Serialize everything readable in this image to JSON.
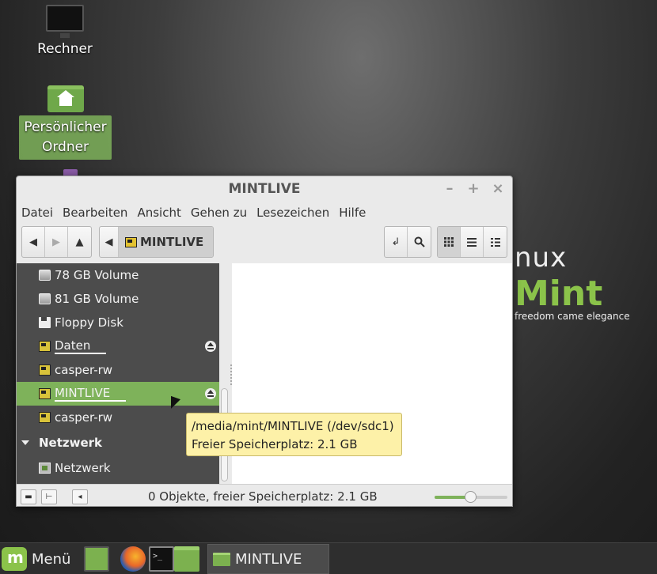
{
  "desktop": {
    "icons": [
      {
        "label": "Rechner"
      },
      {
        "label_line1": "Persönlicher",
        "label_line2": "Ordner"
      }
    ],
    "wallpaper": {
      "logo_part1": "nux",
      "logo_part2": "Mint",
      "slogan": "freedom came elegance"
    }
  },
  "window": {
    "title": "MINTLIVE",
    "controls": {
      "minimize": "–",
      "maximize": "+",
      "close": "×"
    },
    "menu": [
      "Datei",
      "Bearbeiten",
      "Ansicht",
      "Gehen zu",
      "Lesezeichen",
      "Hilfe"
    ],
    "toolbar": {
      "path_label": "MINTLIVE",
      "icons": {
        "back": "arrow-left-icon",
        "forward": "arrow-right-icon",
        "up": "arrow-up-icon",
        "path_toggle": "caret-left-icon",
        "path_drive": "usb-drive-icon",
        "open_terminal": "return-arrow-icon",
        "search": "search-icon",
        "icon_view": "grid-icon",
        "list_view": "list-icon",
        "compact_view": "compact-icon"
      }
    },
    "sidebar": {
      "items": [
        {
          "label": "78 GB Volume",
          "icon": "hard-disk-icon"
        },
        {
          "label": "81 GB Volume",
          "icon": "hard-disk-icon"
        },
        {
          "label": "Floppy Disk",
          "icon": "floppy-icon"
        },
        {
          "label": "Daten",
          "icon": "usb-drive-icon",
          "eject": true
        },
        {
          "label": "casper-rw",
          "icon": "usb-drive-icon"
        },
        {
          "label": "MINTLIVE",
          "icon": "usb-drive-icon",
          "eject": true,
          "selected": true
        },
        {
          "label": "casper-rw",
          "icon": "usb-drive-icon"
        }
      ],
      "network_header": "Netzwerk",
      "network_items": [
        {
          "label": "Netzwerk",
          "icon": "network-icon"
        }
      ]
    },
    "statusbar": {
      "text": "0 Objekte, freier Speicherplatz: 2.1 GB",
      "zoom_level": 0.5
    }
  },
  "tooltip": {
    "line1": "/media/mint/MINTLIVE (/dev/sdc1)",
    "line2": "Freier Speicherplatz: 2.1 GB"
  },
  "panel": {
    "menu_label": "Menü",
    "task_label": "MINTLIVE"
  },
  "colors": {
    "accent": "#7eb25a",
    "sidebar_bg": "#4c4c4c",
    "tooltip_bg": "#fdf1a8"
  }
}
